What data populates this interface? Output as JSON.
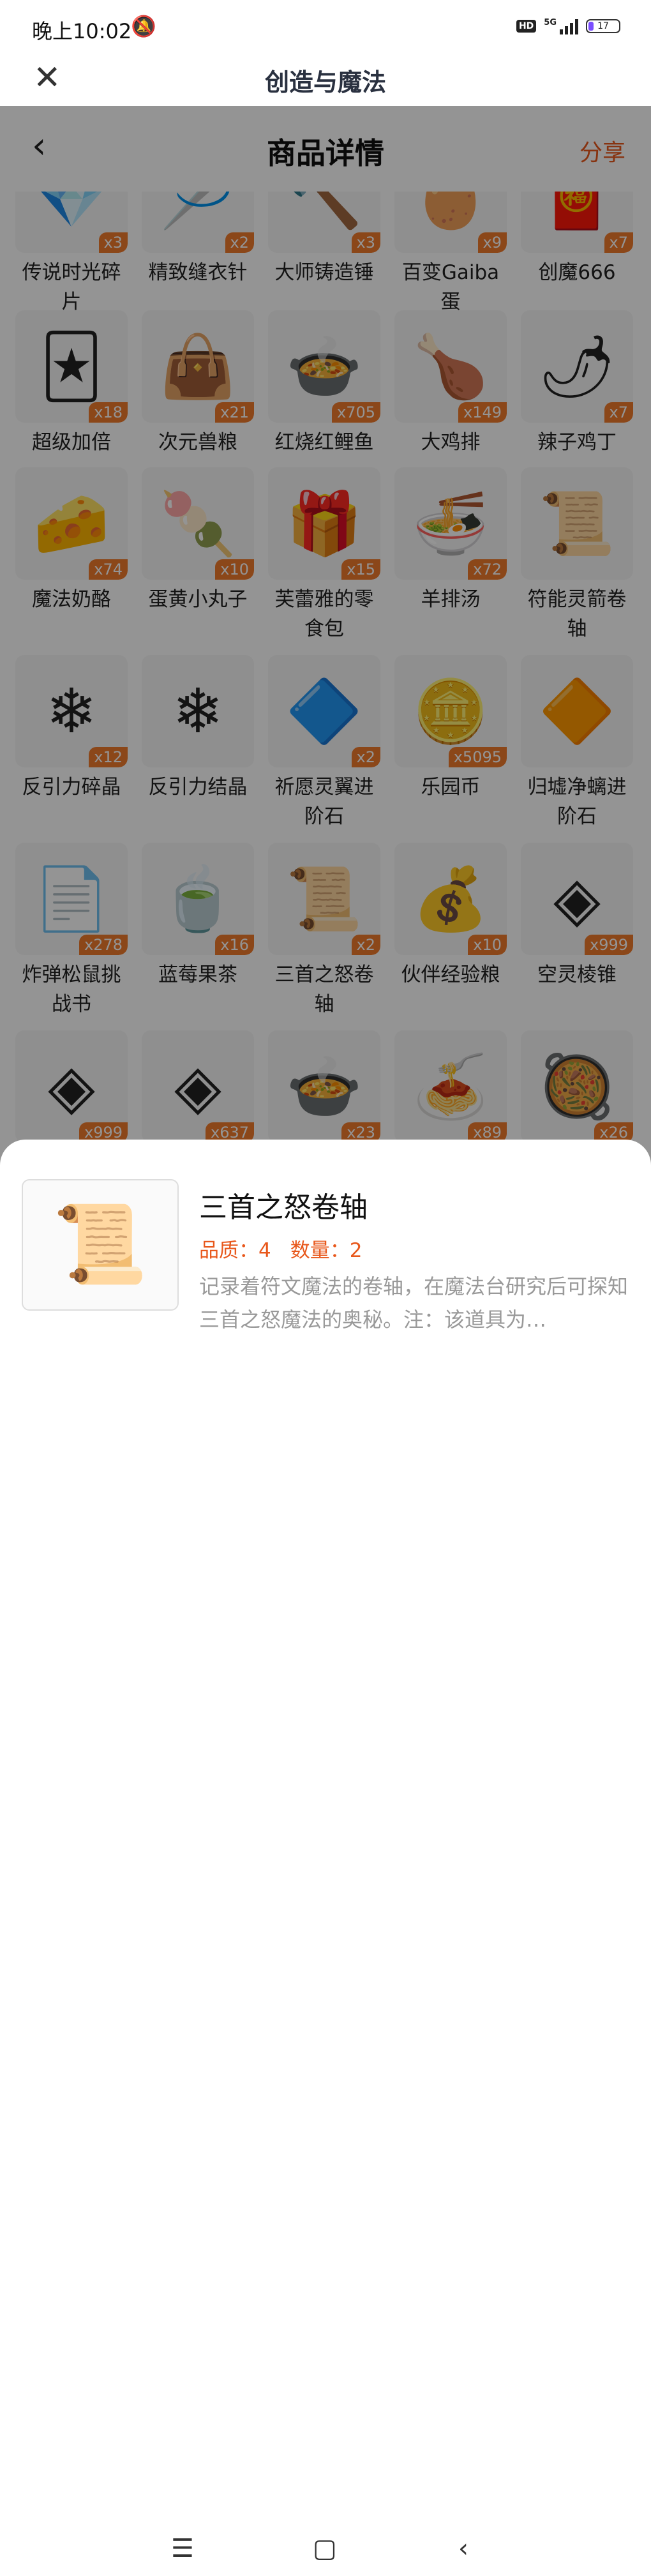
{
  "status": {
    "time": "晚上10:02",
    "hd": "HD",
    "net": "5G",
    "battery": "17"
  },
  "app": {
    "title": "创造与魔法"
  },
  "page": {
    "title": "商品详情",
    "share": "分享"
  },
  "rows": [
    [
      {
        "name": "传说时光碎片",
        "qty": "x3",
        "icon": "crystal-shard",
        "glyph": "💎"
      },
      {
        "name": "精致缝衣针",
        "qty": "x2",
        "icon": "needle",
        "glyph": "🪡"
      },
      {
        "name": "大师铸造锤",
        "qty": "x3",
        "icon": "hammer",
        "glyph": "🔨"
      },
      {
        "name": "百变Gaiba蛋",
        "qty": "x9",
        "icon": "egg",
        "glyph": "🥚"
      },
      {
        "name": "创魔666",
        "qty": "x7",
        "icon": "red-box",
        "glyph": "🧧"
      }
    ],
    [
      {
        "name": "超级加倍",
        "qty": "x18",
        "icon": "cards",
        "glyph": "🃏"
      },
      {
        "name": "次元兽粮",
        "qty": "x21",
        "icon": "food-bag",
        "glyph": "👜"
      },
      {
        "name": "红烧红鲤鱼",
        "qty": "x705",
        "icon": "fish-dish",
        "glyph": "🍲"
      },
      {
        "name": "大鸡排",
        "qty": "x149",
        "icon": "chicken-cutlet",
        "glyph": "🍗"
      },
      {
        "name": "辣子鸡丁",
        "qty": "x7",
        "icon": "spicy-chicken",
        "glyph": "🌶"
      }
    ],
    [
      {
        "name": "魔法奶酪",
        "qty": "x74",
        "icon": "cheese",
        "glyph": "🧀"
      },
      {
        "name": "蛋黄小丸子",
        "qty": "x10",
        "icon": "skewer",
        "glyph": "🍡"
      },
      {
        "name": "芙蕾雅的零食包",
        "qty": "x15",
        "icon": "snack-pack",
        "glyph": "🎁"
      },
      {
        "name": "羊排汤",
        "qty": "x72",
        "icon": "soup",
        "glyph": "🍜"
      },
      {
        "name": "符能灵箭卷轴",
        "qty": "",
        "icon": "scroll",
        "glyph": "📜"
      }
    ],
    [
      {
        "name": "反引力碎晶",
        "qty": "x12",
        "icon": "crystal-blue",
        "glyph": "❄"
      },
      {
        "name": "反引力结晶",
        "qty": "",
        "icon": "crystal-blue",
        "glyph": "❄"
      },
      {
        "name": "祈愿灵翼进阶石",
        "qty": "x2",
        "icon": "purple-gem",
        "glyph": "🔷"
      },
      {
        "name": "乐园币",
        "qty": "x5095",
        "icon": "coin",
        "glyph": "🪙"
      },
      {
        "name": "归墟净螭进阶石",
        "qty": "",
        "icon": "purple-gem",
        "glyph": "🔶"
      }
    ],
    [
      {
        "name": "炸弹松鼠挑战书",
        "qty": "x278",
        "icon": "wanted-scroll",
        "glyph": "📄"
      },
      {
        "name": "蓝莓果茶",
        "qty": "x16",
        "icon": "tea-cup",
        "glyph": "🍵"
      },
      {
        "name": "三首之怒卷轴",
        "qty": "x2",
        "icon": "scroll",
        "glyph": "📜"
      },
      {
        "name": "伙伴经验粮",
        "qty": "x10",
        "icon": "paw-bag",
        "glyph": "💰"
      },
      {
        "name": "空灵棱锥",
        "qty": "x999",
        "icon": "pyramid",
        "glyph": "◈"
      }
    ],
    [
      {
        "name": "",
        "qty": "x999",
        "icon": "pyramid",
        "glyph": "◈"
      },
      {
        "name": "",
        "qty": "x637",
        "icon": "pyramid",
        "glyph": "◈"
      },
      {
        "name": "",
        "qty": "x23",
        "icon": "fish-dish",
        "glyph": "🍲"
      },
      {
        "name": "",
        "qty": "x89",
        "icon": "noodles",
        "glyph": "🍝"
      },
      {
        "name": "",
        "qty": "x26",
        "icon": "stew-pot",
        "glyph": "🥘"
      }
    ]
  ],
  "detail": {
    "name": "三首之怒卷轴",
    "quality": "品质：4",
    "count": "数量：2",
    "desc": "记录着符文魔法的卷轴，在魔法台研究后可探知三首之怒魔法的奥秘。注：该道具为…",
    "icon": "scroll",
    "glyph": "📜"
  }
}
